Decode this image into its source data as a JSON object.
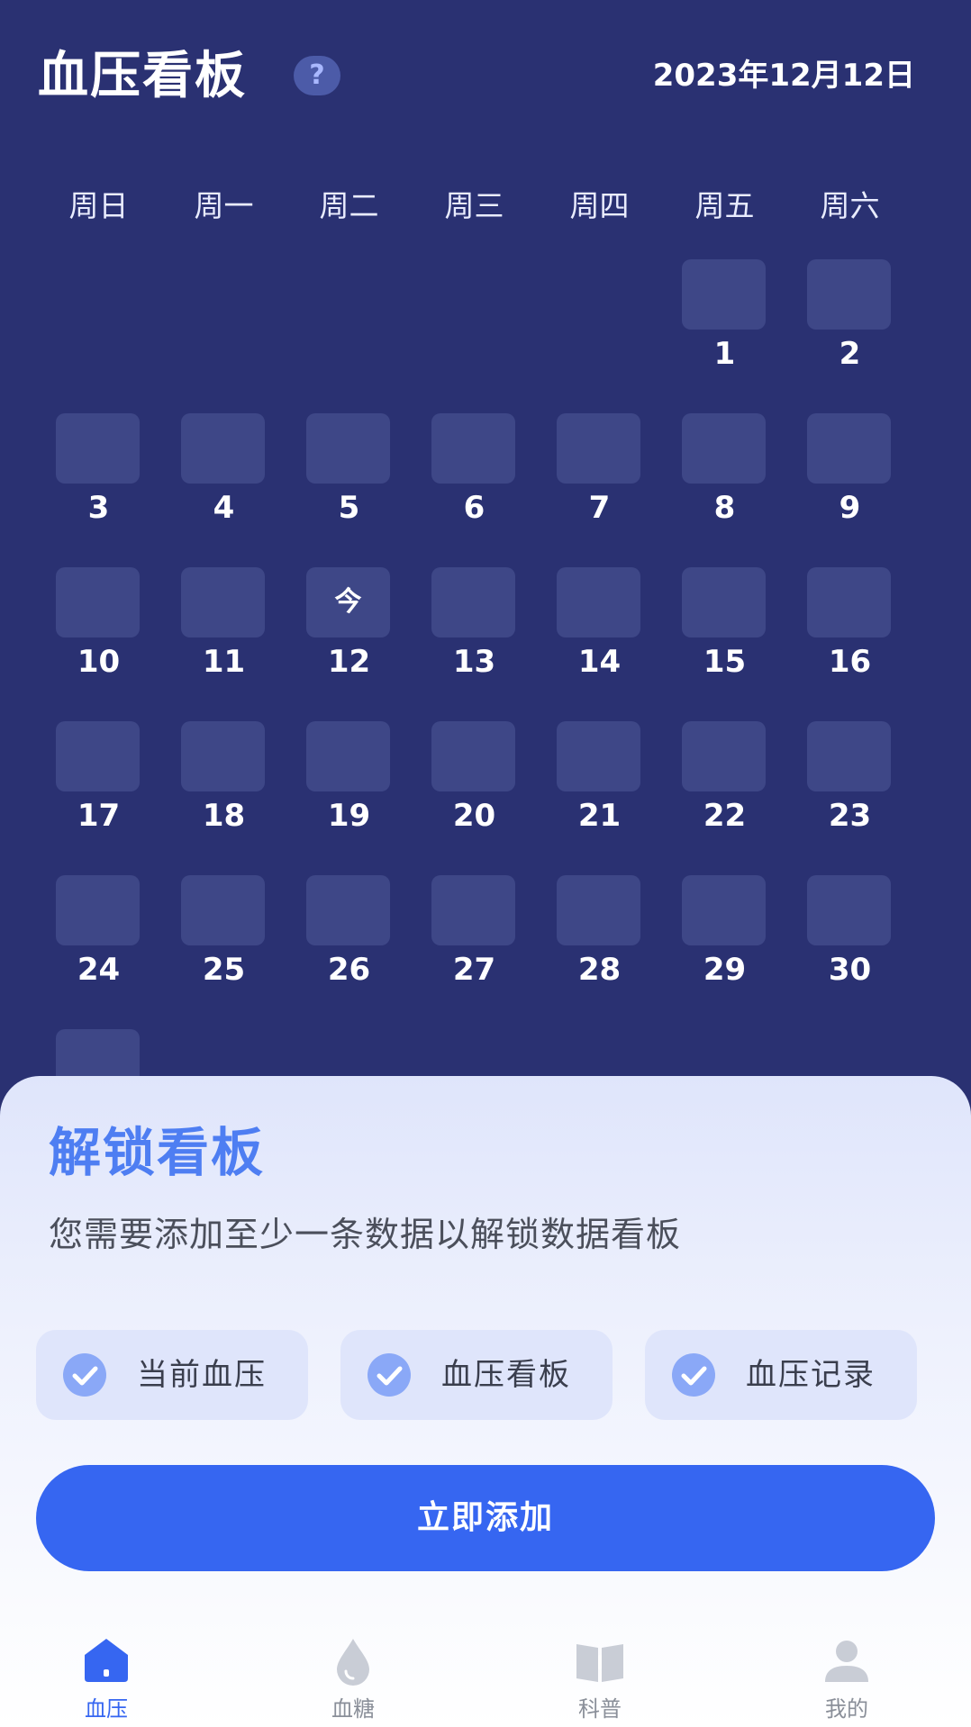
{
  "header": {
    "title": "血压看板",
    "help_icon": "?",
    "date": "2023年12月12日"
  },
  "calendar": {
    "weekdays": [
      "周日",
      "周一",
      "周二",
      "周三",
      "周四",
      "周五",
      "周六"
    ],
    "today_marker": "今",
    "days": [
      {
        "n": "1",
        "col": 5,
        "row": 0
      },
      {
        "n": "2",
        "col": 6,
        "row": 0
      },
      {
        "n": "3",
        "col": 0,
        "row": 1
      },
      {
        "n": "4",
        "col": 1,
        "row": 1
      },
      {
        "n": "5",
        "col": 2,
        "row": 1
      },
      {
        "n": "6",
        "col": 3,
        "row": 1
      },
      {
        "n": "7",
        "col": 4,
        "row": 1
      },
      {
        "n": "8",
        "col": 5,
        "row": 1
      },
      {
        "n": "9",
        "col": 6,
        "row": 1
      },
      {
        "n": "10",
        "col": 0,
        "row": 2
      },
      {
        "n": "11",
        "col": 1,
        "row": 2
      },
      {
        "n": "12",
        "col": 2,
        "row": 2,
        "today": true
      },
      {
        "n": "13",
        "col": 3,
        "row": 2
      },
      {
        "n": "14",
        "col": 4,
        "row": 2
      },
      {
        "n": "15",
        "col": 5,
        "row": 2
      },
      {
        "n": "16",
        "col": 6,
        "row": 2
      },
      {
        "n": "17",
        "col": 0,
        "row": 3
      },
      {
        "n": "18",
        "col": 1,
        "row": 3
      },
      {
        "n": "19",
        "col": 2,
        "row": 3
      },
      {
        "n": "20",
        "col": 3,
        "row": 3
      },
      {
        "n": "21",
        "col": 4,
        "row": 3
      },
      {
        "n": "22",
        "col": 5,
        "row": 3
      },
      {
        "n": "23",
        "col": 6,
        "row": 3
      },
      {
        "n": "24",
        "col": 0,
        "row": 4
      },
      {
        "n": "25",
        "col": 1,
        "row": 4
      },
      {
        "n": "26",
        "col": 2,
        "row": 4
      },
      {
        "n": "27",
        "col": 3,
        "row": 4
      },
      {
        "n": "28",
        "col": 4,
        "row": 4
      },
      {
        "n": "29",
        "col": 5,
        "row": 4
      },
      {
        "n": "30",
        "col": 6,
        "row": 4
      },
      {
        "n": "",
        "col": 0,
        "row": 5
      }
    ]
  },
  "unlock_sheet": {
    "title": "解锁看板",
    "description": "您需要添加至少一条数据以解锁数据看板",
    "features": [
      "当前血压",
      "血压看板",
      "血压记录"
    ],
    "cta_label": "立即添加"
  },
  "tabbar": {
    "items": [
      {
        "label": "血压",
        "icon": "home-icon",
        "active": true
      },
      {
        "label": "血糖",
        "icon": "drop-icon",
        "active": false
      },
      {
        "label": "科普",
        "icon": "book-icon",
        "active": false
      },
      {
        "label": "我的",
        "icon": "user-icon",
        "active": false
      }
    ]
  },
  "colors": {
    "background": "#2a3172",
    "day_tile": "#3e4787",
    "accent": "#3666f1",
    "sheet_title": "#4e7ef2"
  }
}
